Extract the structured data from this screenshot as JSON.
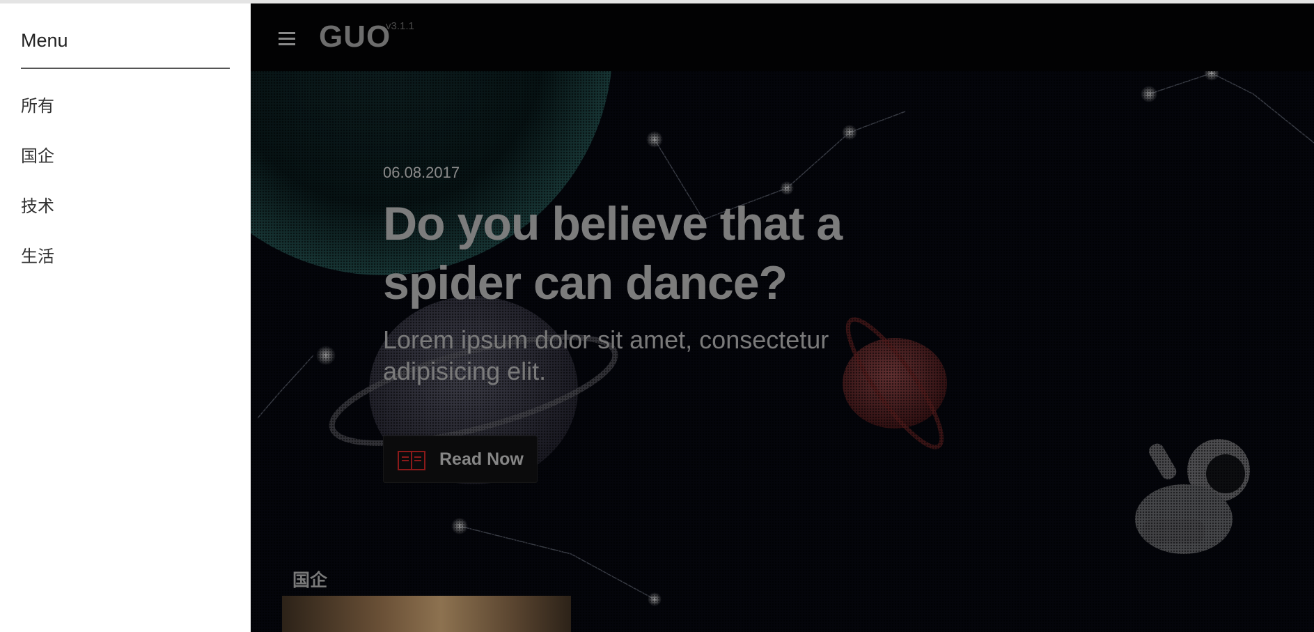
{
  "sidebar": {
    "title": "Menu",
    "items": [
      {
        "label": "所有"
      },
      {
        "label": "国企"
      },
      {
        "label": "技术"
      },
      {
        "label": "生活"
      }
    ]
  },
  "header": {
    "logo": "GUO",
    "version": "v3.1.1",
    "menu_icon": "hamburger-icon"
  },
  "hero": {
    "date": "06.08.2017",
    "headline": "Do you believe that a spider can dance?",
    "subtitle": "Lorem ipsum dolor sit amet, consectetur adipisicing elit.",
    "button_label": "Read Now",
    "button_icon": "book-icon"
  },
  "section": {
    "label": "国企"
  },
  "colors": {
    "background": "#05060c",
    "accent": "#8b1a1a",
    "sidebar_bg": "#ffffff"
  }
}
